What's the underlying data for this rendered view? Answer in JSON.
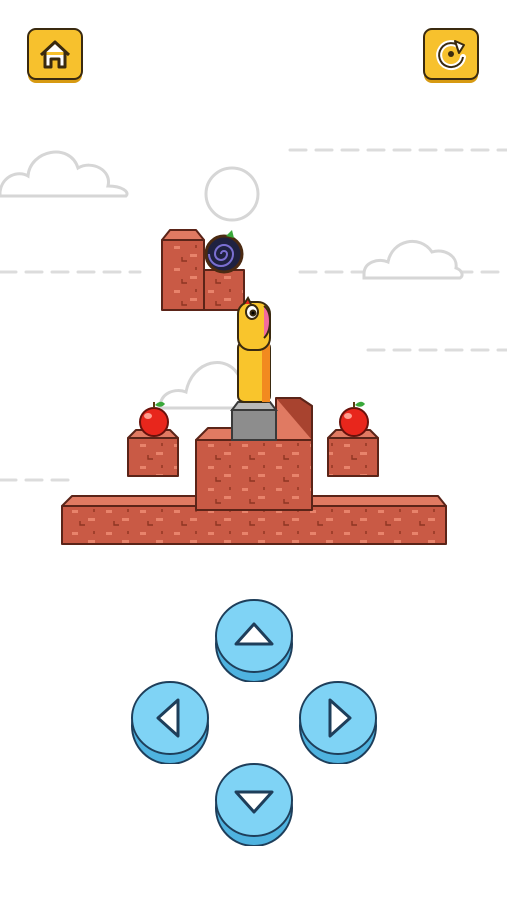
{
  "screen": "snake-puzzle-level",
  "colors": {
    "background": "#ffffff",
    "decor_stroke": "#d9d9d9",
    "brick_front": "#c95a45",
    "brick_top": "#e07a62",
    "brick_side": "#a8432f",
    "button_yellow": "#f7c12d",
    "button_yellow_dark": "#d79a12",
    "dpad_blue": "#7fd3f5",
    "dpad_blue_dark": "#4fb3e0",
    "worm_yellow": "#f9c52c",
    "worm_orange": "#f28a1f",
    "apple_red": "#e8261c",
    "portal_dark": "#1f2140"
  },
  "top_bar": {
    "home_button": {
      "icon": "home-icon"
    },
    "restart_button": {
      "icon": "restart-icon"
    }
  },
  "level": {
    "apples": 2,
    "worm_segments": 3,
    "exit": "portal-icon"
  },
  "controls": {
    "up": {
      "icon": "arrow-up-icon"
    },
    "left": {
      "icon": "arrow-left-icon"
    },
    "right": {
      "icon": "arrow-right-icon"
    },
    "down": {
      "icon": "arrow-down-icon"
    }
  }
}
